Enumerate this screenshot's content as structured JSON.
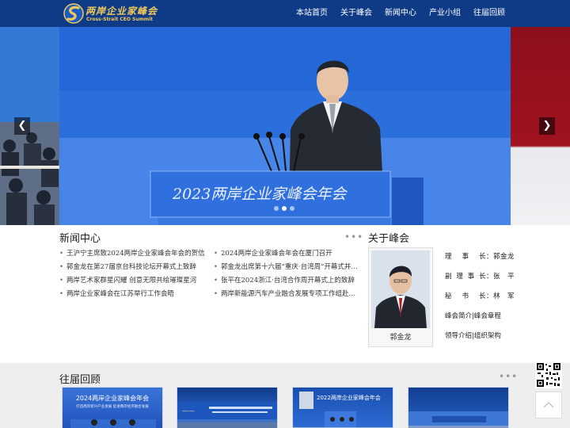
{
  "brand": {
    "name_cn": "两岸企业家峰会",
    "name_en": "Cross-Strait CEO Summit",
    "accent": "#0f3a86",
    "gold": "#f1c95a"
  },
  "nav": [
    "本站首页",
    "关于峰会",
    "新闻中心",
    "产业小组",
    "往届回顾"
  ],
  "banner": {
    "podium_text": "2023两岸企业家峰会年会",
    "prev_icon": "chevron-left-icon",
    "next_icon": "chevron-right-icon",
    "slide_count": 3,
    "active_slide": 1
  },
  "news": {
    "title": "新闻中心",
    "more": "•••",
    "left": [
      "王沪宁主席致2024两岸企业家峰会年会的贺信",
      "郭金龙在第27届京台科技论坛开幕式上致辞",
      "两岸艺术家群星闪耀 创意无限共绘璀璨星河",
      "两岸企业家峰会在江苏举行工作会晤"
    ],
    "right": [
      "2024两岸企业家峰会年会在厦门召开",
      "郭金龙出席第十六届“重庆·台湾周”开幕式并…",
      "张平在2024浙江·台湾合作周开幕式上的致辞",
      "两岸新能源汽车产业融合发展专项工作组赴常…"
    ]
  },
  "about": {
    "title": "关于峰会",
    "portrait_caption": "郭金龙",
    "staff": [
      {
        "role": "理事长",
        "name": "郭金龙"
      },
      {
        "role": "副理事长",
        "name": "张　平"
      },
      {
        "role": "秘书长",
        "name": "林　军"
      }
    ],
    "links": [
      [
        "峰会简介",
        "峰会章程"
      ],
      [
        "领导介绍",
        "组织架构"
      ]
    ],
    "separator": "|"
  },
  "past": {
    "title": "往届回顾",
    "more": "•••",
    "thumbs": [
      {
        "caption": "2024两岸企业家峰会年会",
        "sub": "打造两岸新兴产业发展 促进两岸经济融合发展",
        "bg": "#1c4fb8"
      },
      {
        "caption": "",
        "sub": "",
        "bg": "#2a63c8"
      },
      {
        "caption": "2022两岸企业家峰会年会",
        "sub": "",
        "bg": "#1f5cc4"
      },
      {
        "caption": "",
        "sub": "",
        "bg": "#2b67cc"
      }
    ]
  },
  "side": {
    "qr_icon": "qr-code-icon",
    "top_icon": "back-to-top-icon"
  }
}
